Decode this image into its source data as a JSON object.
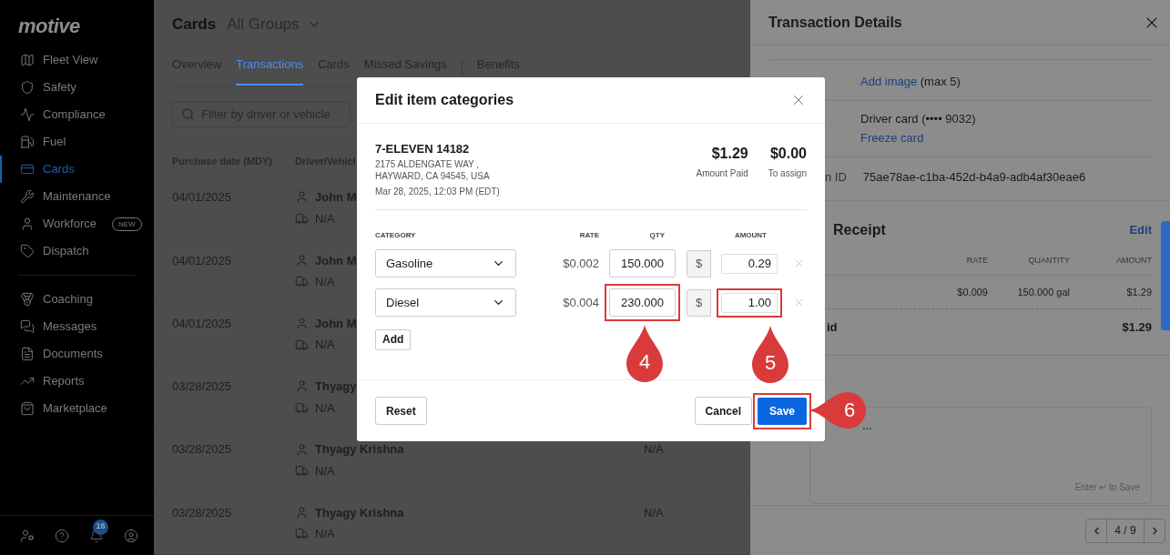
{
  "sidebar": {
    "logo": "motive",
    "primary": [
      {
        "label": "Fleet View",
        "selected": false
      },
      {
        "label": "Safety",
        "selected": false
      },
      {
        "label": "Compliance",
        "selected": false
      },
      {
        "label": "Fuel",
        "selected": false
      },
      {
        "label": "Cards",
        "selected": true
      },
      {
        "label": "Maintenance",
        "selected": false
      },
      {
        "label": "Workforce",
        "selected": false,
        "badge": "NEW"
      },
      {
        "label": "Dispatch",
        "selected": false
      }
    ],
    "secondary": [
      {
        "label": "Coaching",
        "selected": false
      },
      {
        "label": "Messages",
        "selected": false
      },
      {
        "label": "Documents",
        "selected": false
      },
      {
        "label": "Reports",
        "selected": false
      },
      {
        "label": "Marketplace",
        "selected": false
      }
    ],
    "notification_count": "16"
  },
  "page": {
    "title": "Cards",
    "group_selector": "All Groups",
    "tabs": [
      {
        "label": "Overview",
        "selected": false
      },
      {
        "label": "Transactions",
        "selected": true
      },
      {
        "label": "Cards",
        "selected": false
      },
      {
        "label": "Missed Savings",
        "selected": false
      },
      {
        "label": "Benefits",
        "selected": false
      }
    ],
    "search": {
      "placeholder": "Filter by driver or vehicle"
    },
    "table": {
      "columns": [
        "Purchase date (MDY)",
        "Driver/Vehicl"
      ],
      "rows": [
        {
          "date": "04/01/2025",
          "driver": "John M",
          "vehicle": "N/A"
        },
        {
          "date": "04/01/2025",
          "driver": "John M",
          "vehicle": "N/A"
        },
        {
          "date": "04/01/2025",
          "driver": "John M",
          "vehicle": "N/A"
        },
        {
          "date": "03/28/2025",
          "driver": "Thyagy",
          "vehicle": "N/A"
        },
        {
          "date": "03/28/2025",
          "driver": "Thyagy Krishna",
          "vehicle": "N/A",
          "column_3": "N/A"
        },
        {
          "date": "03/28/2025",
          "driver": "Thyagy Krishna",
          "vehicle": "N/A",
          "column_3": "N/A"
        }
      ]
    }
  },
  "details": {
    "title": "Transaction Details",
    "add_image_link": "Add image",
    "add_image_note": "(max 5)",
    "card": "Driver card (•••• 9032)",
    "freeze_link": "Freeze card",
    "id_label": "n ID",
    "id_value": "75ae78ae-c1ba-452d-b4a9-adb4af30eae6",
    "receipt": {
      "title": "Receipt",
      "edit": "Edit",
      "columns": [
        "RATE",
        "QUANTITY",
        "AMOUNT"
      ],
      "row": [
        "$0.009",
        "150.000 gal",
        "$1.29"
      ],
      "total_label": "id",
      "total": "$1.29"
    },
    "notes": {
      "value": "...",
      "hint": "Enter ↵ to Save"
    },
    "pager": "4 / 9"
  },
  "modal": {
    "title": "Edit item categories",
    "merchant": "7-ELEVEN 14182",
    "address": [
      "2175 ALDENGATE WAY ,",
      "HAYWARD, CA 94545, USA"
    ],
    "datetime": "Mar 28, 2025, 12:03 PM (EDT)",
    "totals": [
      {
        "value": "$1.29",
        "label": "Amount Paid"
      },
      {
        "value": "$0.00",
        "label": "To assign"
      }
    ],
    "columns": [
      "CATEGORY",
      "RATE",
      "QTY",
      "AMOUNT"
    ],
    "items": [
      {
        "category": "Gasoline",
        "rate": "$0.002",
        "qty": "150.000",
        "currency": "$",
        "amount": "0.29",
        "qty_highlighted": false,
        "amount_highlighted": false
      },
      {
        "category": "Diesel",
        "rate": "$0.004",
        "qty": "230.000",
        "currency": "$",
        "amount": "1.00",
        "qty_highlighted": true,
        "amount_highlighted": true
      }
    ],
    "add": "Add",
    "reset": "Reset",
    "cancel": "Cancel",
    "save": "Save",
    "save_highlighted": true
  },
  "markers": [
    {
      "label": "4",
      "kind": "up"
    },
    {
      "label": "5",
      "kind": "up"
    },
    {
      "label": "6",
      "kind": "left"
    }
  ]
}
